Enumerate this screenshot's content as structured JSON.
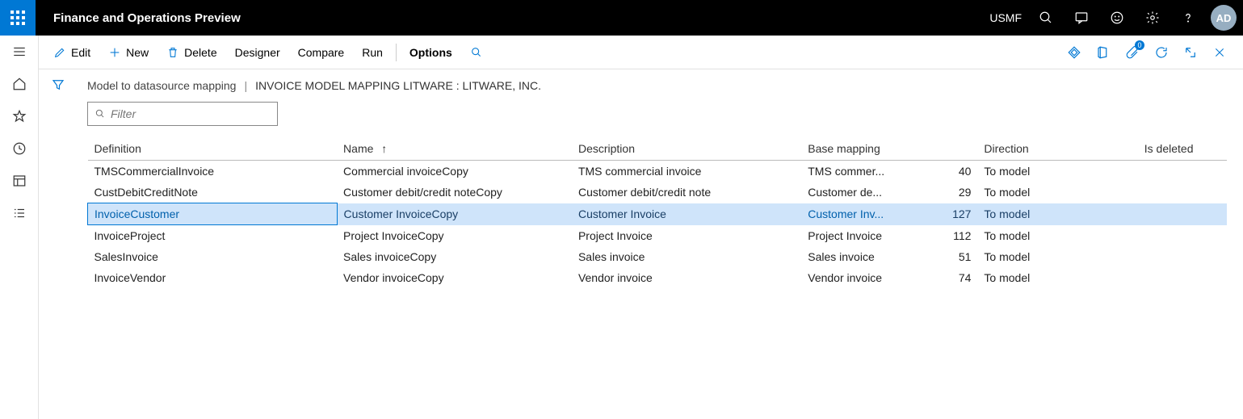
{
  "topbar": {
    "app_title": "Finance and Operations Preview",
    "company": "USMF",
    "avatar": "AD"
  },
  "cmdbar": {
    "edit": "Edit",
    "new": "New",
    "delete": "Delete",
    "designer": "Designer",
    "compare": "Compare",
    "run": "Run",
    "options": "Options",
    "attach_badge": "0"
  },
  "breadcrumb": {
    "root": "Model to datasource mapping",
    "page": "INVOICE MODEL MAPPING LITWARE : LITWARE, INC."
  },
  "filter": {
    "placeholder": "Filter"
  },
  "columns": {
    "definition": "Definition",
    "name": "Name",
    "description": "Description",
    "base_mapping": "Base mapping",
    "direction": "Direction",
    "is_deleted": "Is deleted"
  },
  "rows": [
    {
      "definition": "TMSCommercialInvoice",
      "name": "Commercial invoiceCopy",
      "description": "TMS commercial invoice",
      "base": "TMS commer...",
      "num": "40",
      "direction": "To model",
      "selected": false
    },
    {
      "definition": "CustDebitCreditNote",
      "name": "Customer debit/credit noteCopy",
      "description": "Customer debit/credit note",
      "base": "Customer de...",
      "num": "29",
      "direction": "To model",
      "selected": false
    },
    {
      "definition": "InvoiceCustomer",
      "name": "Customer InvoiceCopy",
      "description": "Customer Invoice",
      "base": "Customer Inv...",
      "num": "127",
      "direction": "To model",
      "selected": true
    },
    {
      "definition": "InvoiceProject",
      "name": "Project InvoiceCopy",
      "description": "Project Invoice",
      "base": "Project Invoice",
      "num": "112",
      "direction": "To model",
      "selected": false
    },
    {
      "definition": "SalesInvoice",
      "name": "Sales invoiceCopy",
      "description": "Sales invoice",
      "base": "Sales invoice",
      "num": "51",
      "direction": "To model",
      "selected": false
    },
    {
      "definition": "InvoiceVendor",
      "name": "Vendor invoiceCopy",
      "description": "Vendor invoice",
      "base": "Vendor invoice",
      "num": "74",
      "direction": "To model",
      "selected": false
    }
  ]
}
